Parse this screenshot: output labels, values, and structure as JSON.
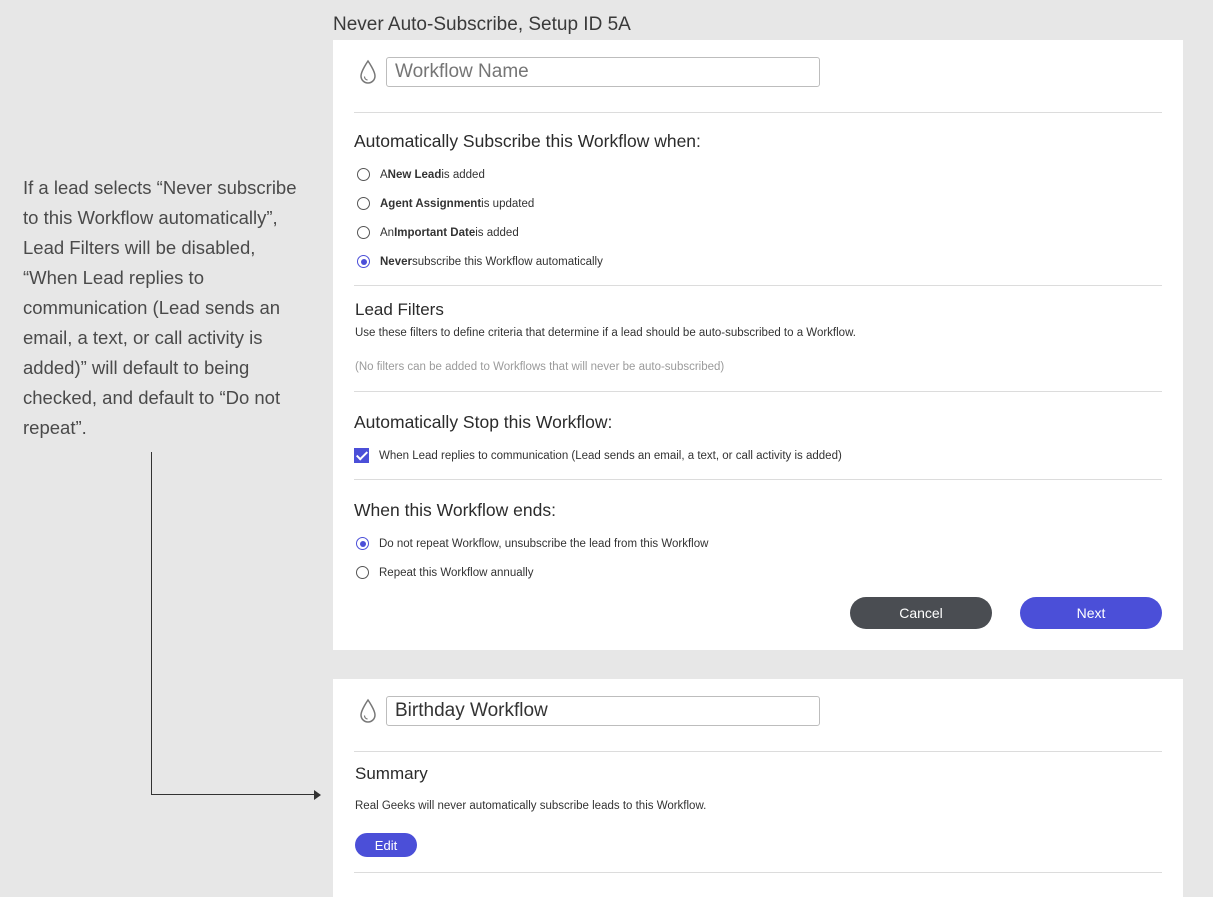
{
  "page": {
    "setup_title": "Never Auto-Subscribe, Setup ID 5A",
    "note": "If a lead selects “Never subscribe to this Workflow automatically”, Lead Filters will be disabled, “When Lead replies to communication (Lead sends an email, a text, or call activity is added)” will default to being checked, and default to “Do not repeat”."
  },
  "colors": {
    "accent": "#4b4fd8",
    "cancel": "#4a4d52",
    "background": "#e7e7e7"
  },
  "form": {
    "workflow_name_placeholder": "Workflow Name",
    "subscribe_title": "Automatically Subscribe this Workflow when:",
    "subscribe_options": [
      {
        "pre": "A ",
        "bold": "New Lead",
        "post": " is added",
        "selected": false
      },
      {
        "pre": "",
        "bold": "Agent Assignment",
        "post": " is updated",
        "selected": false
      },
      {
        "pre": "An ",
        "bold": "Important Date",
        "post": " is added",
        "selected": false
      },
      {
        "pre": "",
        "bold": "Never",
        "post": " subscribe this Workflow automatically",
        "selected": true
      }
    ],
    "filters_title": "Lead Filters",
    "filters_desc": "Use these filters to define criteria that determine if a lead should be auto-subscribed to a Workflow.",
    "filters_disabled_note": "(No filters can be added to Workflows that will never be auto-subscribed)",
    "stop_title": "Automatically Stop this Workflow:",
    "stop_option": {
      "label": "When Lead replies to communication (Lead sends an email, a text, or call activity is added)",
      "checked": true
    },
    "ends_title": "When this Workflow ends:",
    "ends_options": [
      {
        "label": "Do not repeat Workflow, unsubscribe the lead from this Workflow",
        "selected": true
      },
      {
        "label": "Repeat this Workflow annually",
        "selected": false
      }
    ],
    "cancel_label": "Cancel",
    "next_label": "Next"
  },
  "summary_card": {
    "workflow_name_value": "Birthday Workflow",
    "summary_title": "Summary",
    "summary_text": "Real Geeks will never automatically subscribe leads to this Workflow.",
    "edit_label": "Edit"
  },
  "icons": {
    "workflow_icon": "drop-icon"
  }
}
